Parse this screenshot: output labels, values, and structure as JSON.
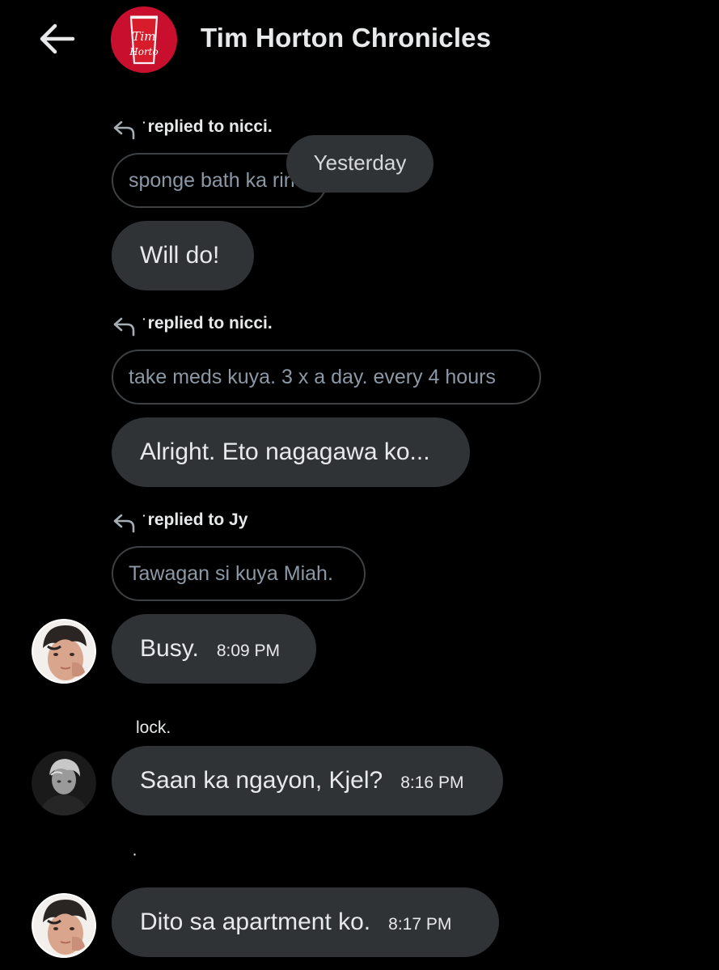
{
  "header": {
    "title": "Tim Horton Chronicles",
    "avatar_logo_text": "Tim Hortons"
  },
  "date_chip": "Yesterday",
  "messages": [
    {
      "replied_to": "replied to nicci.",
      "quoted_text": "sponge bath ka rin",
      "text": "Will do!"
    },
    {
      "replied_to": "replied to nicci.",
      "quoted_text": "take meds kuya. 3 x a day. every 4 hours",
      "text": "Alright. Eto nagagawa ko..."
    },
    {
      "replied_to": "replied to Jy",
      "quoted_text": "Tawagan si kuya Miah.",
      "text": "Busy.",
      "time": "8:09 PM"
    },
    {
      "sender": "lock.",
      "text": "Saan ka ngayon, Kjel?",
      "time": "8:16 PM"
    },
    {
      "sender": "·",
      "text": "Dito sa apartment ko.",
      "time": "8:17 PM"
    }
  ],
  "colors": {
    "background": "#000000",
    "bubble": "#2f3336",
    "quote_border": "#3e4144",
    "quote_text": "#8b98a5",
    "text": "#e7e9ea",
    "logo_red": "#c8102e"
  },
  "icons": {
    "back": "arrow-left-icon",
    "reply": "reply-arrow-icon"
  }
}
